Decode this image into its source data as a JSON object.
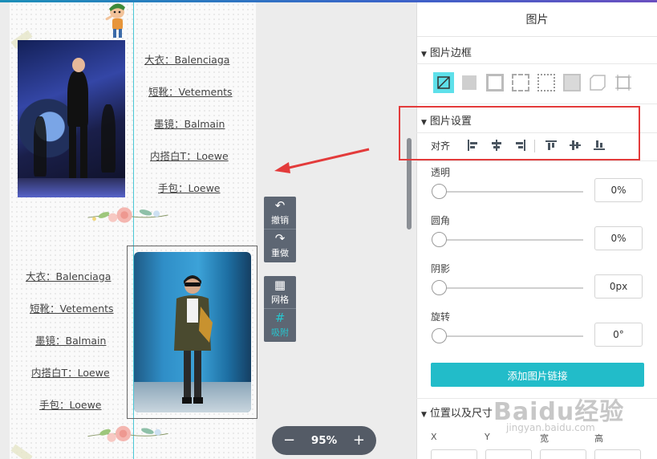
{
  "canvas": {
    "left_labels": [
      "大衣：Balenciaga",
      "短靴：Vetements",
      "墨镜：Balmain",
      "内搭白T：Loewe",
      "手包：Loewe"
    ],
    "right_labels": [
      "大衣：Balenciaga",
      "短靴：Vetements",
      "墨镜：Balmain",
      "内搭白T：Loewe",
      "手包：Loewe"
    ]
  },
  "float_toolbar": {
    "undo_label": "撤销",
    "redo_label": "重做",
    "grid_label": "网格",
    "snap_label": "吸附"
  },
  "zoom": {
    "minus": "−",
    "value": "95%",
    "plus": "+"
  },
  "panel": {
    "title": "图片",
    "border_section": "图片边框",
    "settings_section": "图片设置",
    "align_label": "对齐",
    "sliders": [
      {
        "label": "透明",
        "value": "0%"
      },
      {
        "label": "圆角",
        "value": "0%"
      },
      {
        "label": "阴影",
        "value": "0px"
      },
      {
        "label": "旋转",
        "value": "0°"
      }
    ],
    "add_link_button": "添加图片链接",
    "position_section": "位置以及尺寸",
    "pos_labels": [
      "X",
      "Y",
      "宽",
      "高"
    ]
  },
  "watermark": {
    "brand": "Baidu经验",
    "url": "jingyan.baidu.com"
  },
  "colors": {
    "accent": "#22bcc9",
    "highlight": "#e33b3b",
    "toolbar": "#5d6673"
  }
}
